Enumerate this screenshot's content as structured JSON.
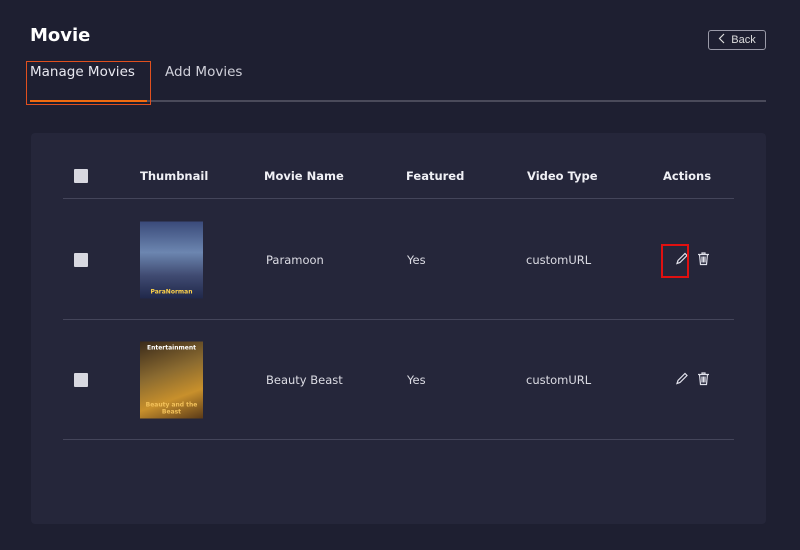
{
  "page": {
    "title": "Movie",
    "back_label": "Back"
  },
  "tabs": [
    {
      "label": "Manage Movies",
      "active": true
    },
    {
      "label": "Add Movies",
      "active": false
    }
  ],
  "table": {
    "headers": [
      "Thumbnail",
      "Movie Name",
      "Featured",
      "Video Type",
      "Actions"
    ],
    "rows": [
      {
        "thumbnail_text": "ParaNorman",
        "name": "Paramoon",
        "featured": "Yes",
        "video_type": "customURL"
      },
      {
        "thumbnail_text": "Entertainment",
        "thumbnail_sub": "Beauty and the Beast",
        "name": "Beauty Beast",
        "featured": "Yes",
        "video_type": "customURL"
      }
    ]
  },
  "colors": {
    "accent": "#f26b0f",
    "highlight": "#e01010",
    "background": "#1e1f31",
    "card": "#25263a"
  }
}
